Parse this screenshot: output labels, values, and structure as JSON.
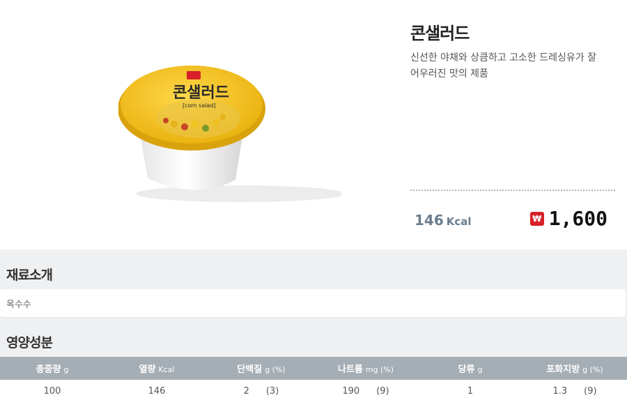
{
  "product": {
    "name": "콘샐러드",
    "description": "신선한 야채와 상큼하고 고소한 드레싱유가 잘 어우러진 맛의 제품",
    "image_label": "콘샐러드",
    "image_sublabel": "[corn salad]",
    "kcal_value": "146",
    "kcal_unit": "Kcal",
    "price_icon": "₩",
    "price": "1,600"
  },
  "ingredients": {
    "title": "재료소개",
    "text": "옥수수"
  },
  "nutrition": {
    "title": "영양성분",
    "headers": [
      {
        "label": "총중량",
        "unit": "g"
      },
      {
        "label": "열량",
        "unit": "Kcal"
      },
      {
        "label": "단백질",
        "unit": "g (%)"
      },
      {
        "label": "나트륨",
        "unit": "mg (%)"
      },
      {
        "label": "당류",
        "unit": "g"
      },
      {
        "label": "포화지방",
        "unit": "g (%)"
      }
    ],
    "values": [
      {
        "value": "100",
        "pct": ""
      },
      {
        "value": "146",
        "pct": ""
      },
      {
        "value": "2",
        "pct": "(3)"
      },
      {
        "value": "190",
        "pct": "(9)"
      },
      {
        "value": "1",
        "pct": ""
      },
      {
        "value": "1.3",
        "pct": "(9)"
      }
    ]
  },
  "colors": {
    "header_bg": "#a5aeb5",
    "kcal": "#6b7e8e",
    "price_icon_bg": "#d91f27",
    "lid_yellow": "#f3c11a"
  }
}
